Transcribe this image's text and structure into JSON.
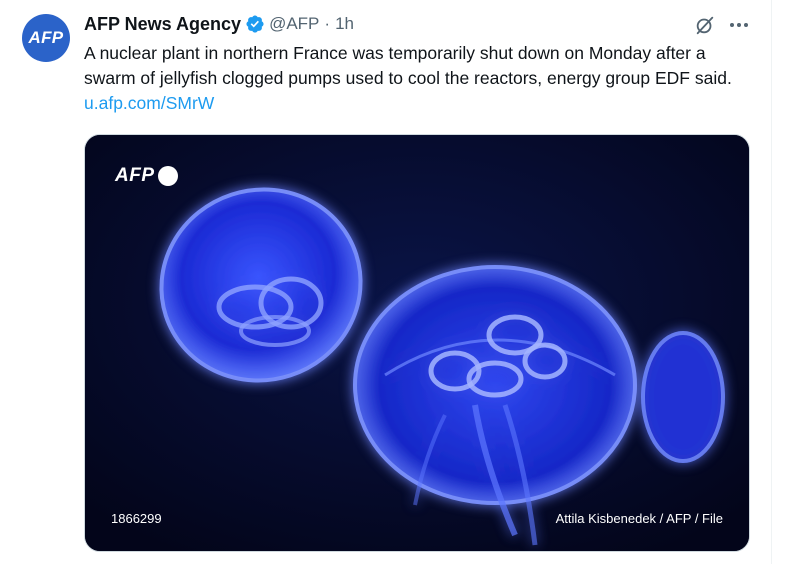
{
  "tweet": {
    "avatar_text": "AFP",
    "author_name": "AFP News Agency",
    "handle": "@AFP",
    "separator": "·",
    "time": "1h",
    "text": "A nuclear plant in northern France was temporarily shut down on Monday after a swarm of jellyfish clogged pumps used to cool the reactors, energy group EDF said. ",
    "link": "u.afp.com/SMrW",
    "icons": {
      "verified": "verified-badge-icon",
      "grok": "grok-icon",
      "more": "more-options-icon"
    }
  },
  "media": {
    "logo_text": "AFP",
    "photo_id": "1866299",
    "credit": "Attila Kisbenedek / AFP / File"
  },
  "colors": {
    "brand": "#2b63c9",
    "link": "#1d9bf0",
    "verified": "#1d9bf0",
    "muted": "#536471"
  }
}
